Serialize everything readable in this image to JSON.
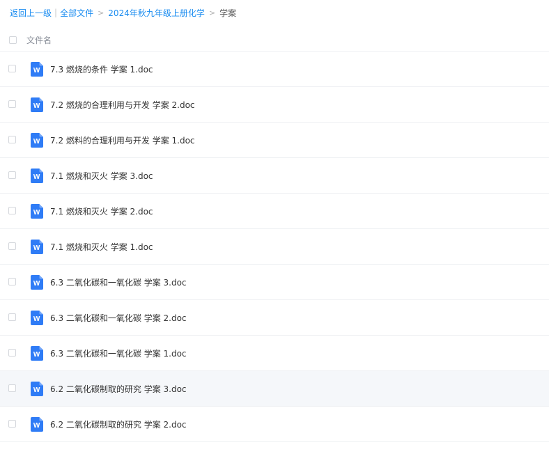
{
  "breadcrumb": {
    "back": "返回上一级",
    "all_files": "全部文件",
    "folder": "2024年秋九年级上册化学",
    "current": "学案",
    "pipe": "|",
    "sep": ">"
  },
  "list": {
    "header_name": "文件名",
    "icon": "word-doc-icon",
    "icon_letter": "W",
    "icon_color": "#2f7cf6",
    "hover_row_index": 9,
    "files": [
      {
        "name": "7.3 燃烧的条件 学案 1.doc"
      },
      {
        "name": "7.2 燃烧的合理利用与开发 学案 2.doc"
      },
      {
        "name": "7.2 燃料的合理利用与开发 学案 1.doc"
      },
      {
        "name": "7.1 燃烧和灭火 学案 3.doc"
      },
      {
        "name": "7.1 燃烧和灭火 学案 2.doc"
      },
      {
        "name": "7.1 燃烧和灭火 学案 1.doc"
      },
      {
        "name": "6.3 二氧化碳和一氧化碳 学案 3.doc"
      },
      {
        "name": "6.3 二氧化碳和一氧化碳 学案 2.doc"
      },
      {
        "name": "6.3 二氧化碳和一氧化碳 学案 1.doc"
      },
      {
        "name": "6.2 二氧化碳制取的研究 学案 3.doc"
      },
      {
        "name": "6.2 二氧化碳制取的研究 学案 2.doc"
      }
    ]
  }
}
